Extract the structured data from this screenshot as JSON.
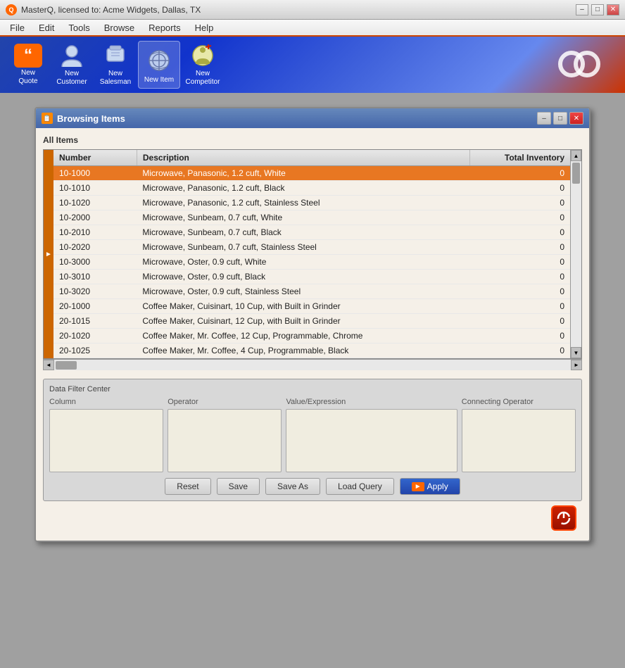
{
  "window": {
    "title": "MasterQ,  licensed to: Acme Widgets, Dallas, TX",
    "icon": "Q"
  },
  "menu": {
    "items": [
      "File",
      "Edit",
      "Tools",
      "Browse",
      "Reports",
      "Help"
    ]
  },
  "toolbar": {
    "buttons": [
      {
        "id": "new-quote",
        "label": "New\nQuote",
        "icon": "quote"
      },
      {
        "id": "new-customer",
        "label": "New\nCustomer",
        "icon": "customer"
      },
      {
        "id": "new-salesman",
        "label": "New\nSalesman",
        "icon": "salesman"
      },
      {
        "id": "new-item",
        "label": "New Item",
        "icon": "item",
        "highlighted": true
      },
      {
        "id": "new-competitor",
        "label": "New\nCompetitor",
        "icon": "competitor"
      }
    ]
  },
  "browse_window": {
    "title": "Browsing Items",
    "section_label": "All Items",
    "columns": [
      "Number",
      "Description",
      "Total Inventory"
    ],
    "rows": [
      {
        "number": "10-1000",
        "description": "Microwave, Panasonic, 1.2 cuft, White",
        "inventory": "0",
        "selected": true
      },
      {
        "number": "10-1010",
        "description": "Microwave, Panasonic, 1.2 cuft, Black",
        "inventory": "0"
      },
      {
        "number": "10-1020",
        "description": "Microwave, Panasonic, 1.2 cuft, Stainless Steel",
        "inventory": "0"
      },
      {
        "number": "10-2000",
        "description": "Microwave, Sunbeam, 0.7 cuft, White",
        "inventory": "0"
      },
      {
        "number": "10-2010",
        "description": "Microwave, Sunbeam, 0.7 cuft, Black",
        "inventory": "0"
      },
      {
        "number": "10-2020",
        "description": "Microwave, Sunbeam, 0.7 cuft, Stainless Steel",
        "inventory": "0"
      },
      {
        "number": "10-3000",
        "description": "Microwave, Oster, 0.9 cuft, White",
        "inventory": "0"
      },
      {
        "number": "10-3010",
        "description": "Microwave, Oster, 0.9 cuft, Black",
        "inventory": "0"
      },
      {
        "number": "10-3020",
        "description": "Microwave, Oster, 0.9 cuft, Stainless Steel",
        "inventory": "0"
      },
      {
        "number": "20-1000",
        "description": "Coffee Maker, Cuisinart, 10 Cup, with Built in Grinder",
        "inventory": "0"
      },
      {
        "number": "20-1015",
        "description": "Coffee Maker, Cuisinart, 12 Cup, with Built in Grinder",
        "inventory": "0"
      },
      {
        "number": "20-1020",
        "description": "Coffee Maker, Mr. Coffee, 12 Cup, Programmable, Chrome",
        "inventory": "0"
      },
      {
        "number": "20-1025",
        "description": "Coffee Maker, Mr. Coffee, 4 Cup, Programmable, Black",
        "inventory": "0"
      }
    ]
  },
  "filter": {
    "legend": "Data Filter Center",
    "col_header_column": "Column",
    "col_header_operator": "Operator",
    "col_header_value": "Value/Expression",
    "col_header_connecting": "Connecting Operator",
    "buttons": {
      "reset": "Reset",
      "save": "Save",
      "save_as": "Save As",
      "load_query": "Load Query",
      "apply": "Apply"
    }
  }
}
